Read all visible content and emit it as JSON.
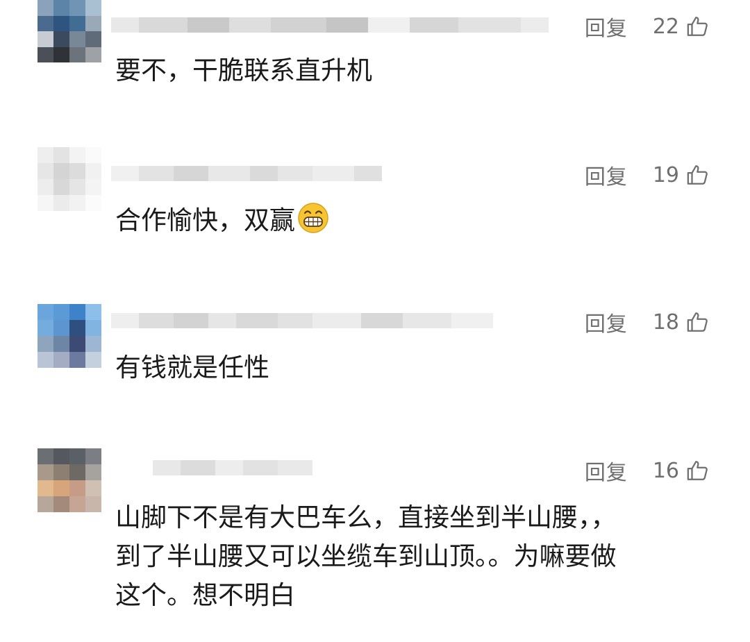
{
  "comments": [
    {
      "reply_label": "回复",
      "likes": "22",
      "text": "要不，干脆联系直升机",
      "emoji": ""
    },
    {
      "reply_label": "回复",
      "likes": "19",
      "text": "合作愉快，双赢",
      "emoji": "grinning-face-emoji"
    },
    {
      "reply_label": "回复",
      "likes": "18",
      "text": "有钱就是任性",
      "emoji": ""
    },
    {
      "reply_label": "回复",
      "likes": "16",
      "text_lines": [
        "山脚下不是有大巴车么，直接坐到半山腰，，",
        "到了半山腰又可以坐缆车到山顶。。为嘛要做",
        "这个。想不明白"
      ],
      "emoji": ""
    }
  ],
  "icons": {
    "like": "thumbs-up-icon",
    "avatar": "pixelated-avatar"
  },
  "colors": {
    "action_text": "#6f6f6f",
    "comment_text": "#1a1a1a",
    "background": "#ffffff"
  }
}
